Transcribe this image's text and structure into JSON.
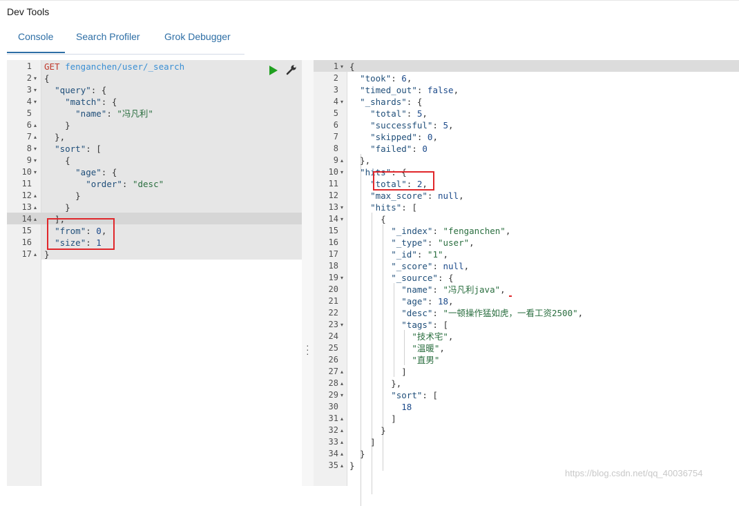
{
  "app": {
    "title": "Dev Tools"
  },
  "tabs": [
    {
      "label": "Console",
      "active": true
    },
    {
      "label": "Search Profiler",
      "active": false
    },
    {
      "label": "Grok Debugger",
      "active": false
    }
  ],
  "request": {
    "lines": [
      {
        "n": "1",
        "fold": "",
        "parts": [
          [
            "m",
            "GET"
          ],
          [
            "p",
            " "
          ],
          [
            "u",
            "fenganchen/user/_search"
          ]
        ]
      },
      {
        "n": "2",
        "fold": "▾",
        "parts": [
          [
            "p",
            "{"
          ]
        ]
      },
      {
        "n": "3",
        "fold": "▾",
        "parts": [
          [
            "p",
            "  "
          ],
          [
            "k",
            "\"query\""
          ],
          [
            "p",
            ": {"
          ]
        ]
      },
      {
        "n": "4",
        "fold": "▾",
        "parts": [
          [
            "p",
            "    "
          ],
          [
            "k",
            "\"match\""
          ],
          [
            "p",
            ": {"
          ]
        ]
      },
      {
        "n": "5",
        "fold": "",
        "parts": [
          [
            "p",
            "      "
          ],
          [
            "k",
            "\"name\""
          ],
          [
            "p",
            ": "
          ],
          [
            "s",
            "\"冯凡利\""
          ]
        ]
      },
      {
        "n": "6",
        "fold": "▴",
        "parts": [
          [
            "p",
            "    }"
          ]
        ]
      },
      {
        "n": "7",
        "fold": "▴",
        "parts": [
          [
            "p",
            "  },"
          ]
        ]
      },
      {
        "n": "8",
        "fold": "▾",
        "parts": [
          [
            "p",
            "  "
          ],
          [
            "k",
            "\"sort\""
          ],
          [
            "p",
            ": ["
          ]
        ]
      },
      {
        "n": "9",
        "fold": "▾",
        "parts": [
          [
            "p",
            "    {"
          ]
        ]
      },
      {
        "n": "10",
        "fold": "▾",
        "parts": [
          [
            "p",
            "      "
          ],
          [
            "k",
            "\"age\""
          ],
          [
            "p",
            ": {"
          ]
        ]
      },
      {
        "n": "11",
        "fold": "",
        "parts": [
          [
            "p",
            "        "
          ],
          [
            "k",
            "\"order\""
          ],
          [
            "p",
            ": "
          ],
          [
            "s",
            "\"desc\""
          ]
        ]
      },
      {
        "n": "12",
        "fold": "▴",
        "parts": [
          [
            "p",
            "      }"
          ]
        ]
      },
      {
        "n": "13",
        "fold": "▴",
        "parts": [
          [
            "p",
            "    }"
          ]
        ]
      },
      {
        "n": "14",
        "fold": "▴",
        "parts": [
          [
            "p",
            "  ],"
          ]
        ]
      },
      {
        "n": "15",
        "fold": "",
        "parts": [
          [
            "p",
            "  "
          ],
          [
            "k",
            "\"from\""
          ],
          [
            "p",
            ": "
          ],
          [
            "n",
            "0"
          ],
          [
            "p",
            ","
          ]
        ]
      },
      {
        "n": "16",
        "fold": "",
        "parts": [
          [
            "p",
            "  "
          ],
          [
            "k",
            "\"size\""
          ],
          [
            "p",
            ": "
          ],
          [
            "n",
            "1"
          ]
        ]
      },
      {
        "n": "17",
        "fold": "▴",
        "parts": [
          [
            "p",
            "}"
          ]
        ]
      }
    ]
  },
  "response": {
    "lines": [
      {
        "n": "1",
        "fold": "▾",
        "parts": [
          [
            "p",
            "{"
          ]
        ]
      },
      {
        "n": "2",
        "fold": "",
        "parts": [
          [
            "p",
            "  "
          ],
          [
            "k",
            "\"took\""
          ],
          [
            "p",
            ": "
          ],
          [
            "n",
            "6"
          ],
          [
            "p",
            ","
          ]
        ]
      },
      {
        "n": "3",
        "fold": "",
        "parts": [
          [
            "p",
            "  "
          ],
          [
            "k",
            "\"timed_out\""
          ],
          [
            "p",
            ": "
          ],
          [
            "b",
            "false"
          ],
          [
            "p",
            ","
          ]
        ]
      },
      {
        "n": "4",
        "fold": "▾",
        "parts": [
          [
            "p",
            "  "
          ],
          [
            "k",
            "\"_shards\""
          ],
          [
            "p",
            ": {"
          ]
        ]
      },
      {
        "n": "5",
        "fold": "",
        "parts": [
          [
            "p",
            "    "
          ],
          [
            "k",
            "\"total\""
          ],
          [
            "p",
            ": "
          ],
          [
            "n",
            "5"
          ],
          [
            "p",
            ","
          ]
        ]
      },
      {
        "n": "6",
        "fold": "",
        "parts": [
          [
            "p",
            "    "
          ],
          [
            "k",
            "\"successful\""
          ],
          [
            "p",
            ": "
          ],
          [
            "n",
            "5"
          ],
          [
            "p",
            ","
          ]
        ]
      },
      {
        "n": "7",
        "fold": "",
        "parts": [
          [
            "p",
            "    "
          ],
          [
            "k",
            "\"skipped\""
          ],
          [
            "p",
            ": "
          ],
          [
            "n",
            "0"
          ],
          [
            "p",
            ","
          ]
        ]
      },
      {
        "n": "8",
        "fold": "",
        "parts": [
          [
            "p",
            "    "
          ],
          [
            "k",
            "\"failed\""
          ],
          [
            "p",
            ": "
          ],
          [
            "n",
            "0"
          ]
        ]
      },
      {
        "n": "9",
        "fold": "▴",
        "parts": [
          [
            "p",
            "  },"
          ]
        ]
      },
      {
        "n": "10",
        "fold": "▾",
        "parts": [
          [
            "p",
            "  "
          ],
          [
            "k",
            "\"hits\""
          ],
          [
            "p",
            ": {"
          ]
        ]
      },
      {
        "n": "11",
        "fold": "",
        "parts": [
          [
            "p",
            "    "
          ],
          [
            "k",
            "\"total\""
          ],
          [
            "p",
            ": "
          ],
          [
            "n",
            "2"
          ],
          [
            "p",
            ","
          ]
        ]
      },
      {
        "n": "12",
        "fold": "",
        "parts": [
          [
            "p",
            "    "
          ],
          [
            "k",
            "\"max_score\""
          ],
          [
            "p",
            ": "
          ],
          [
            "b",
            "null"
          ],
          [
            "p",
            ","
          ]
        ]
      },
      {
        "n": "13",
        "fold": "▾",
        "parts": [
          [
            "p",
            "    "
          ],
          [
            "k",
            "\"hits\""
          ],
          [
            "p",
            ": ["
          ]
        ]
      },
      {
        "n": "14",
        "fold": "▾",
        "parts": [
          [
            "p",
            "      {"
          ]
        ]
      },
      {
        "n": "15",
        "fold": "",
        "parts": [
          [
            "p",
            "        "
          ],
          [
            "k",
            "\"_index\""
          ],
          [
            "p",
            ": "
          ],
          [
            "s",
            "\"fenganchen\""
          ],
          [
            "p",
            ","
          ]
        ]
      },
      {
        "n": "16",
        "fold": "",
        "parts": [
          [
            "p",
            "        "
          ],
          [
            "k",
            "\"_type\""
          ],
          [
            "p",
            ": "
          ],
          [
            "s",
            "\"user\""
          ],
          [
            "p",
            ","
          ]
        ]
      },
      {
        "n": "17",
        "fold": "",
        "parts": [
          [
            "p",
            "        "
          ],
          [
            "k",
            "\"_id\""
          ],
          [
            "p",
            ": "
          ],
          [
            "s",
            "\"1\""
          ],
          [
            "p",
            ","
          ]
        ]
      },
      {
        "n": "18",
        "fold": "",
        "parts": [
          [
            "p",
            "        "
          ],
          [
            "k",
            "\"_score\""
          ],
          [
            "p",
            ": "
          ],
          [
            "b",
            "null"
          ],
          [
            "p",
            ","
          ]
        ]
      },
      {
        "n": "19",
        "fold": "▾",
        "parts": [
          [
            "p",
            "        "
          ],
          [
            "k",
            "\"_source\""
          ],
          [
            "p",
            ": {"
          ]
        ]
      },
      {
        "n": "20",
        "fold": "",
        "parts": [
          [
            "p",
            "          "
          ],
          [
            "k",
            "\"name\""
          ],
          [
            "p",
            ": "
          ],
          [
            "s",
            "\"冯凡利java\""
          ],
          [
            "p",
            ","
          ]
        ]
      },
      {
        "n": "21",
        "fold": "",
        "parts": [
          [
            "p",
            "          "
          ],
          [
            "k",
            "\"age\""
          ],
          [
            "p",
            ": "
          ],
          [
            "n",
            "18"
          ],
          [
            "p",
            ","
          ]
        ]
      },
      {
        "n": "22",
        "fold": "",
        "parts": [
          [
            "p",
            "          "
          ],
          [
            "k",
            "\"desc\""
          ],
          [
            "p",
            ": "
          ],
          [
            "s",
            "\"一顿操作猛如虎，一看工资2500\""
          ],
          [
            "p",
            ","
          ]
        ]
      },
      {
        "n": "23",
        "fold": "▾",
        "parts": [
          [
            "p",
            "          "
          ],
          [
            "k",
            "\"tags\""
          ],
          [
            "p",
            ": ["
          ]
        ]
      },
      {
        "n": "24",
        "fold": "",
        "parts": [
          [
            "p",
            "            "
          ],
          [
            "s",
            "\"技术宅\""
          ],
          [
            "p",
            ","
          ]
        ]
      },
      {
        "n": "25",
        "fold": "",
        "parts": [
          [
            "p",
            "            "
          ],
          [
            "s",
            "\"温暖\""
          ],
          [
            "p",
            ","
          ]
        ]
      },
      {
        "n": "26",
        "fold": "",
        "parts": [
          [
            "p",
            "            "
          ],
          [
            "s",
            "\"直男\""
          ]
        ]
      },
      {
        "n": "27",
        "fold": "▴",
        "parts": [
          [
            "p",
            "          ]"
          ]
        ]
      },
      {
        "n": "28",
        "fold": "▴",
        "parts": [
          [
            "p",
            "        },"
          ]
        ]
      },
      {
        "n": "29",
        "fold": "▾",
        "parts": [
          [
            "p",
            "        "
          ],
          [
            "k",
            "\"sort\""
          ],
          [
            "p",
            ": ["
          ]
        ]
      },
      {
        "n": "30",
        "fold": "",
        "parts": [
          [
            "p",
            "          "
          ],
          [
            "n",
            "18"
          ]
        ]
      },
      {
        "n": "31",
        "fold": "▴",
        "parts": [
          [
            "p",
            "        ]"
          ]
        ]
      },
      {
        "n": "32",
        "fold": "▴",
        "parts": [
          [
            "p",
            "      }"
          ]
        ]
      },
      {
        "n": "33",
        "fold": "▴",
        "parts": [
          [
            "p",
            "    ]"
          ]
        ]
      },
      {
        "n": "34",
        "fold": "▴",
        "parts": [
          [
            "p",
            "  }"
          ]
        ]
      },
      {
        "n": "35",
        "fold": "▴",
        "parts": [
          [
            "p",
            "}"
          ]
        ]
      }
    ]
  },
  "icons": {
    "run": "play-icon",
    "settings": "wrench-icon",
    "resize": "vertical-dots-icon"
  },
  "colors": {
    "accent": "#2d6ea5",
    "highlight_box": "#e0262a",
    "run_button": "#20a020"
  },
  "watermark": "https://blog.csdn.net/qq_40036754"
}
